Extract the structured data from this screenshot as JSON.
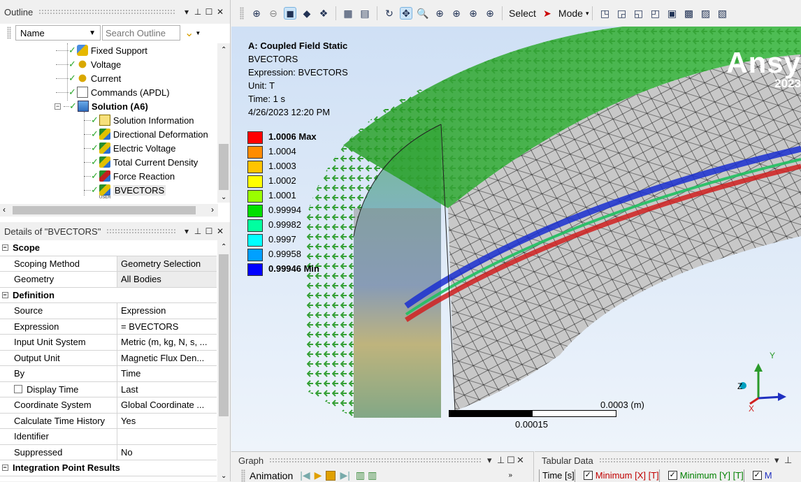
{
  "outline": {
    "title": "Outline",
    "filter_select": "Name",
    "search_placeholder": "Search Outline",
    "tree_items": [
      {
        "label": "Fixed Support"
      },
      {
        "label": "Voltage"
      },
      {
        "label": "Current"
      },
      {
        "label": "Commands (APDL)"
      },
      {
        "label": "Solution (A6)"
      },
      {
        "label": "Solution Information"
      },
      {
        "label": "Directional Deformation"
      },
      {
        "label": "Electric Voltage"
      },
      {
        "label": "Total Current Density"
      },
      {
        "label": "Force Reaction"
      },
      {
        "label": "BVECTORS",
        "badge": "USER"
      }
    ]
  },
  "details": {
    "title": "Details of \"BVECTORS\"",
    "groups": [
      {
        "name": "Scope",
        "rows": [
          {
            "label": "Scoping Method",
            "value": "Geometry Selection"
          },
          {
            "label": "Geometry",
            "value": "All Bodies"
          }
        ]
      },
      {
        "name": "Definition",
        "rows": [
          {
            "label": "Source",
            "value": "Expression"
          },
          {
            "label": "Expression",
            "value": "= BVECTORS"
          },
          {
            "label": "Input Unit System",
            "value": "Metric (m, kg, N, s, ..."
          },
          {
            "label": "Output Unit",
            "value": "Magnetic Flux Den..."
          },
          {
            "label": "By",
            "value": "Time"
          },
          {
            "label": "Display Time",
            "value": "Last"
          },
          {
            "label": "Coordinate System",
            "value": "Global Coordinate ..."
          },
          {
            "label": "Calculate Time History",
            "value": "Yes"
          },
          {
            "label": "Identifier",
            "value": ""
          },
          {
            "label": "Suppressed",
            "value": "No"
          }
        ]
      },
      {
        "name": "Integration Point Results",
        "rows": []
      }
    ]
  },
  "toolbar": {
    "select_label": "Select",
    "mode_label": "Mode"
  },
  "viewport": {
    "result_title": "A: Coupled Field Static",
    "result_name": "BVECTORS",
    "expression": "Expression: BVECTORS",
    "unit": "Unit: T",
    "time": "Time: 1 s",
    "date": "4/26/2023 12:20 PM",
    "legend": [
      {
        "label": "1.0006 Max",
        "color": "#ff0000"
      },
      {
        "label": "1.0004",
        "color": "#ff8c00"
      },
      {
        "label": "1.0003",
        "color": "#ffc400"
      },
      {
        "label": "1.0002",
        "color": "#ffff00"
      },
      {
        "label": "1.0001",
        "color": "#9aff00"
      },
      {
        "label": "0.99994",
        "color": "#00e000"
      },
      {
        "label": "0.99982",
        "color": "#00ffa0"
      },
      {
        "label": "0.9997",
        "color": "#00ffff"
      },
      {
        "label": "0.99958",
        "color": "#00a0ff"
      },
      {
        "label": "0.99946 Min",
        "color": "#0000ff"
      }
    ],
    "brand": "Ansy",
    "brand_year": "2023",
    "scale_top": "0.0003 (m)",
    "scale_bottom": "0.00015",
    "axis_y": "Y",
    "axis_z": "Z",
    "axis_x": "X"
  },
  "graph": {
    "title": "Graph",
    "animation_label": "Animation"
  },
  "tabular": {
    "title": "Tabular Data",
    "col_time": "Time [s]",
    "col_min_x": "Minimum [X] [T]",
    "col_min_y": "Minimum [Y] [T]",
    "col_trunc": "M"
  },
  "colors": {
    "accent": "#0078d7",
    "check": "#2aa72a",
    "min_x": "#c00000",
    "min_y": "#008000"
  }
}
